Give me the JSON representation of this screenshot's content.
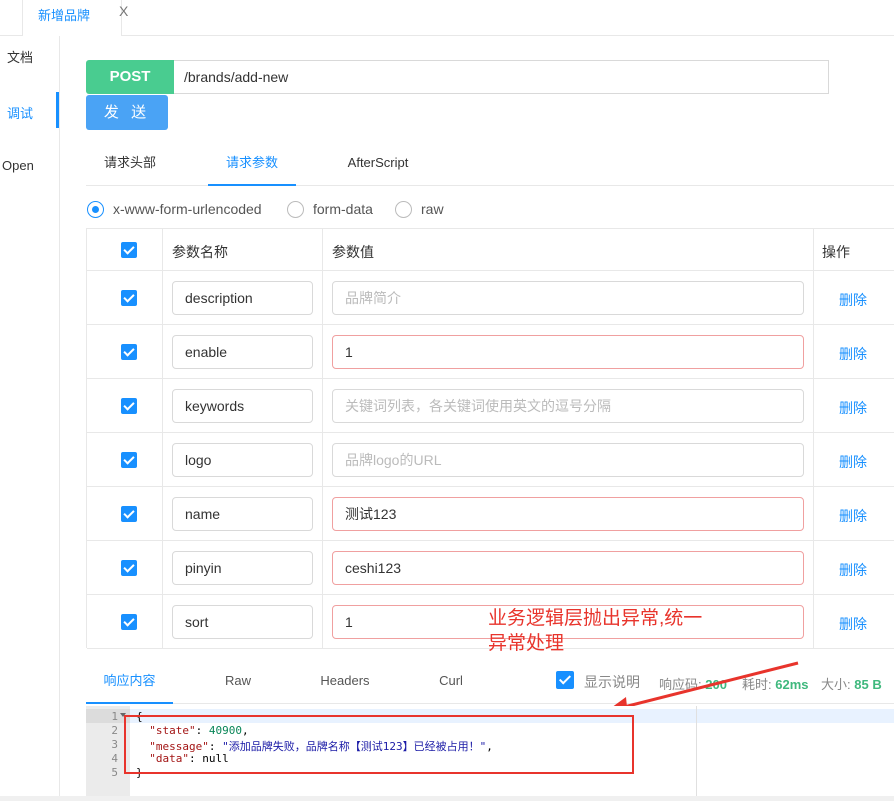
{
  "top_tab": {
    "label": "新增品牌",
    "close": "X"
  },
  "left_nav": {
    "items": [
      "文档",
      "调试",
      "Open"
    ]
  },
  "request": {
    "method": "POST",
    "url": "/brands/add-new",
    "send_label": "发 送"
  },
  "request_tabs": [
    "请求头部",
    "请求参数",
    "AfterScript"
  ],
  "body_types": [
    "x-www-form-urlencoded",
    "form-data",
    "raw"
  ],
  "params_table": {
    "headers": {
      "name": "参数名称",
      "value": "参数值",
      "action": "操作"
    },
    "rows": [
      {
        "name": "description",
        "value": "品牌简介",
        "placeholder": true,
        "required": false,
        "action": "删除"
      },
      {
        "name": "enable",
        "value": "1",
        "placeholder": false,
        "required": true,
        "action": "删除"
      },
      {
        "name": "keywords",
        "value": "关键词列表，各关键词使用英文的逗号分隔",
        "placeholder": true,
        "required": false,
        "action": "删除"
      },
      {
        "name": "logo",
        "value": "品牌logo的URL",
        "placeholder": true,
        "required": false,
        "action": "删除"
      },
      {
        "name": "name",
        "value": "测试123",
        "placeholder": false,
        "required": true,
        "action": "删除"
      },
      {
        "name": "pinyin",
        "value": "ceshi123",
        "placeholder": false,
        "required": true,
        "action": "删除"
      },
      {
        "name": "sort",
        "value": "1",
        "placeholder": false,
        "required": true,
        "action": "删除"
      }
    ]
  },
  "annotation": {
    "line1": "业务逻辑层抛出异常,统一",
    "line2": "异常处理"
  },
  "response_tabs": [
    "响应内容",
    "Raw",
    "Headers",
    "Curl"
  ],
  "response_meta": {
    "show_desc": "显示说明",
    "code_label": "响应码:",
    "code": "200",
    "time_label": "耗时:",
    "time": "62ms",
    "size_label": "大小:",
    "size": "85 B"
  },
  "response_body": {
    "line_numbers": [
      "1",
      "2",
      "3",
      "4",
      "5"
    ],
    "open_brace": "{",
    "state_key": "\"state\"",
    "state_val": "40900",
    "message_key": "\"message\"",
    "message_val": "\"添加品牌失败，品牌名称【测试123】已经被占用！\"",
    "data_key": "\"data\"",
    "data_val": "null",
    "close_brace": "}"
  },
  "colors": {
    "accent": "#1890ff",
    "post": "#49cc90",
    "send": "#4aa3f5",
    "annotation": "#e8342c"
  }
}
